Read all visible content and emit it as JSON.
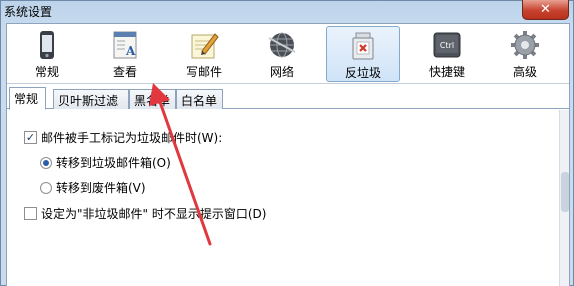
{
  "window": {
    "title": "系统设置",
    "close_glyph": "✕"
  },
  "toolbar": {
    "items": [
      {
        "label": "常规",
        "icon": "phone-icon"
      },
      {
        "label": "查看",
        "icon": "view-icon"
      },
      {
        "label": "写邮件",
        "icon": "pencil-icon"
      },
      {
        "label": "网络",
        "icon": "globe-icon"
      },
      {
        "label": "反垃圾",
        "icon": "antispam-icon",
        "active": true
      },
      {
        "label": "快捷键",
        "icon": "ctrl-key-icon",
        "key_text": "Ctrl"
      },
      {
        "label": "高级",
        "icon": "gear-icon"
      }
    ]
  },
  "tabs": [
    {
      "label": "常规",
      "active": true
    },
    {
      "label": "贝叶斯过滤"
    },
    {
      "label": "黑名单"
    },
    {
      "label": "白名单"
    }
  ],
  "options": {
    "mark_as_spam": {
      "label": "邮件被手工标记为垃圾邮件时(W):",
      "checked": true
    },
    "move_to_spam": {
      "label": "转移到垃圾邮件箱(O)",
      "selected": true
    },
    "move_to_trash": {
      "label": "转移到废件箱(V)",
      "selected": false
    },
    "no_prompt_nonspam": {
      "label": "设定为\"非垃圾邮件\" 时不显示提示窗口(D)",
      "checked": false
    }
  },
  "colors": {
    "accent": "#2a5da8",
    "annotation_arrow": "#e0383e"
  }
}
